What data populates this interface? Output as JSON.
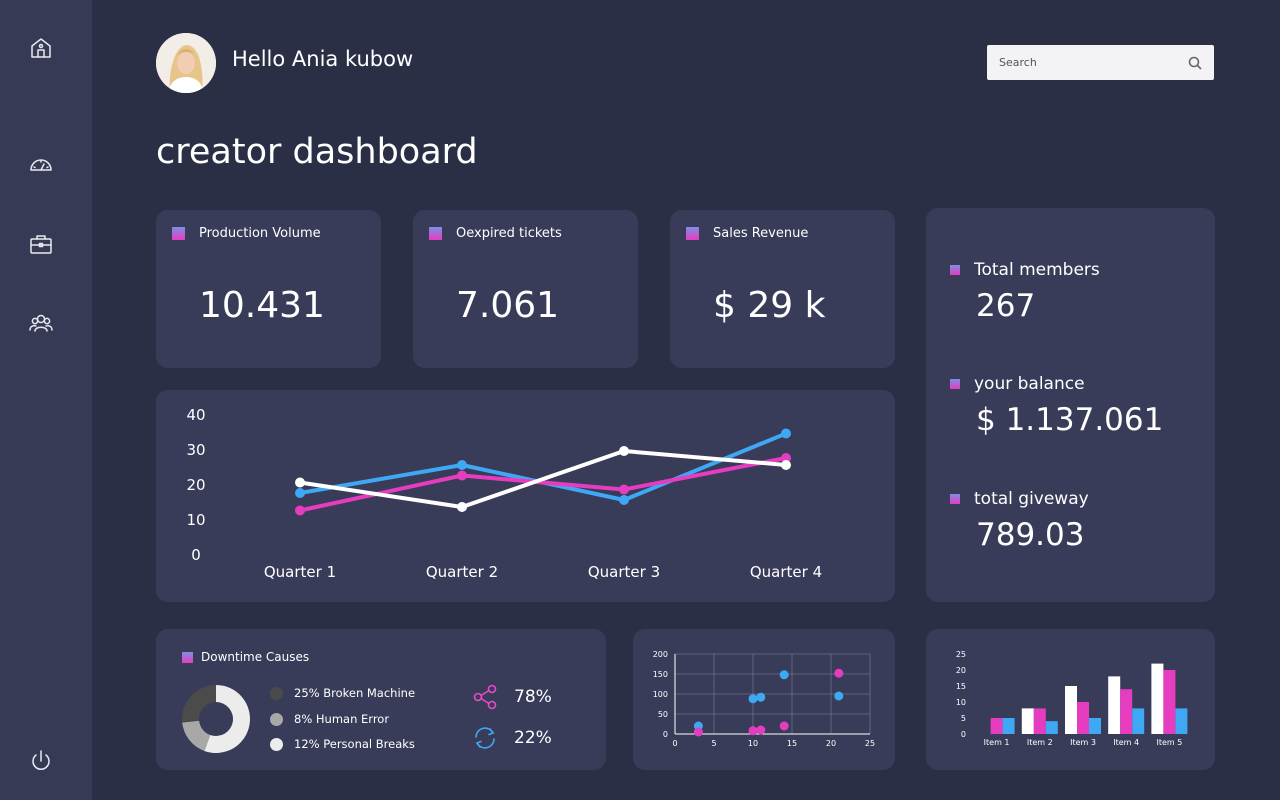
{
  "header": {
    "greeting": "Hello Ania kubow",
    "search_placeholder": "Search",
    "page_title": "creator dashboard"
  },
  "sidebar": {
    "icons": [
      "home-icon",
      "speedometer-icon",
      "briefcase-icon",
      "users-icon",
      "power-icon"
    ]
  },
  "stats": [
    {
      "label": "Production Volume",
      "value": "10.431"
    },
    {
      "label": "Oexpired tickets",
      "value": "7.061"
    },
    {
      "label": "Sales Revenue",
      "value": "$ 29 k"
    }
  ],
  "side_panel": [
    {
      "label": "Total members",
      "value": "267"
    },
    {
      "label": "your balance",
      "value": "$ 1.137.061"
    },
    {
      "label": "total giveway",
      "value": "789.03"
    }
  ],
  "downtime": {
    "title": "Downtime Causes",
    "legend": [
      {
        "label": "25% Broken Machine",
        "color": "#4b4b4b"
      },
      {
        "label": "8% Human Error",
        "color": "#a8a8a8"
      },
      {
        "label": "12% Personal Breaks",
        "color": "#ececec"
      }
    ],
    "metrics": [
      {
        "icon": "share-icon",
        "value": "78%",
        "color": "#e84ac8"
      },
      {
        "icon": "refresh-icon",
        "value": "22%",
        "color": "#3ea8f5"
      }
    ]
  },
  "colors": {
    "blue": "#3ea8f5",
    "pink": "#e63cbf",
    "white": "#ffffff",
    "card": "#383c58",
    "background": "#2b2f45"
  },
  "chart_data": [
    {
      "type": "line",
      "categories": [
        "Quarter 1",
        "Quarter 2",
        "Quarter 3",
        "Quarter 4"
      ],
      "ylim": [
        0,
        40
      ],
      "yticks": [
        "0",
        "10",
        "20",
        "30",
        "40"
      ],
      "series": [
        {
          "color": "#3ea8f5",
          "values": [
            18,
            26,
            16,
            35
          ]
        },
        {
          "color": "#e63cbf",
          "values": [
            13,
            23,
            19,
            28
          ]
        },
        {
          "color": "#ffffff",
          "values": [
            21,
            14,
            30,
            26
          ]
        }
      ]
    },
    {
      "type": "scatter",
      "xlim": [
        0,
        25
      ],
      "ylim": [
        0,
        200
      ],
      "xticks": [
        "0",
        "5",
        "10",
        "15",
        "20",
        "25"
      ],
      "yticks": [
        "0",
        "50",
        "100",
        "150",
        "200"
      ],
      "series": [
        {
          "color": "#3ea8f5",
          "points": [
            [
              3,
              20
            ],
            [
              10,
              88
            ],
            [
              11,
              92
            ],
            [
              14,
              148
            ],
            [
              21,
              95
            ]
          ]
        },
        {
          "color": "#e63cbf",
          "points": [
            [
              3,
              5
            ],
            [
              10,
              8
            ],
            [
              11,
              10
            ],
            [
              14,
              20
            ],
            [
              21,
              152
            ]
          ]
        }
      ]
    },
    {
      "type": "bar",
      "categories": [
        "Item 1",
        "Item 2",
        "Item 3",
        "Item 4",
        "Item 5"
      ],
      "ylim": [
        0,
        25
      ],
      "yticks": [
        "0",
        "5",
        "10",
        "15",
        "20",
        "25"
      ],
      "series": [
        {
          "color": "#ffffff",
          "values": [
            0,
            8,
            15,
            18,
            22
          ]
        },
        {
          "color": "#e63cbf",
          "values": [
            5,
            8,
            10,
            14,
            20
          ]
        },
        {
          "color": "#3ea8f5",
          "values": [
            5,
            4,
            5,
            8,
            8
          ]
        }
      ]
    },
    {
      "type": "pie",
      "values": [
        25,
        8,
        12
      ],
      "colors": [
        "#ececec",
        "#a8a8a8",
        "#4b4b4b"
      ]
    }
  ]
}
